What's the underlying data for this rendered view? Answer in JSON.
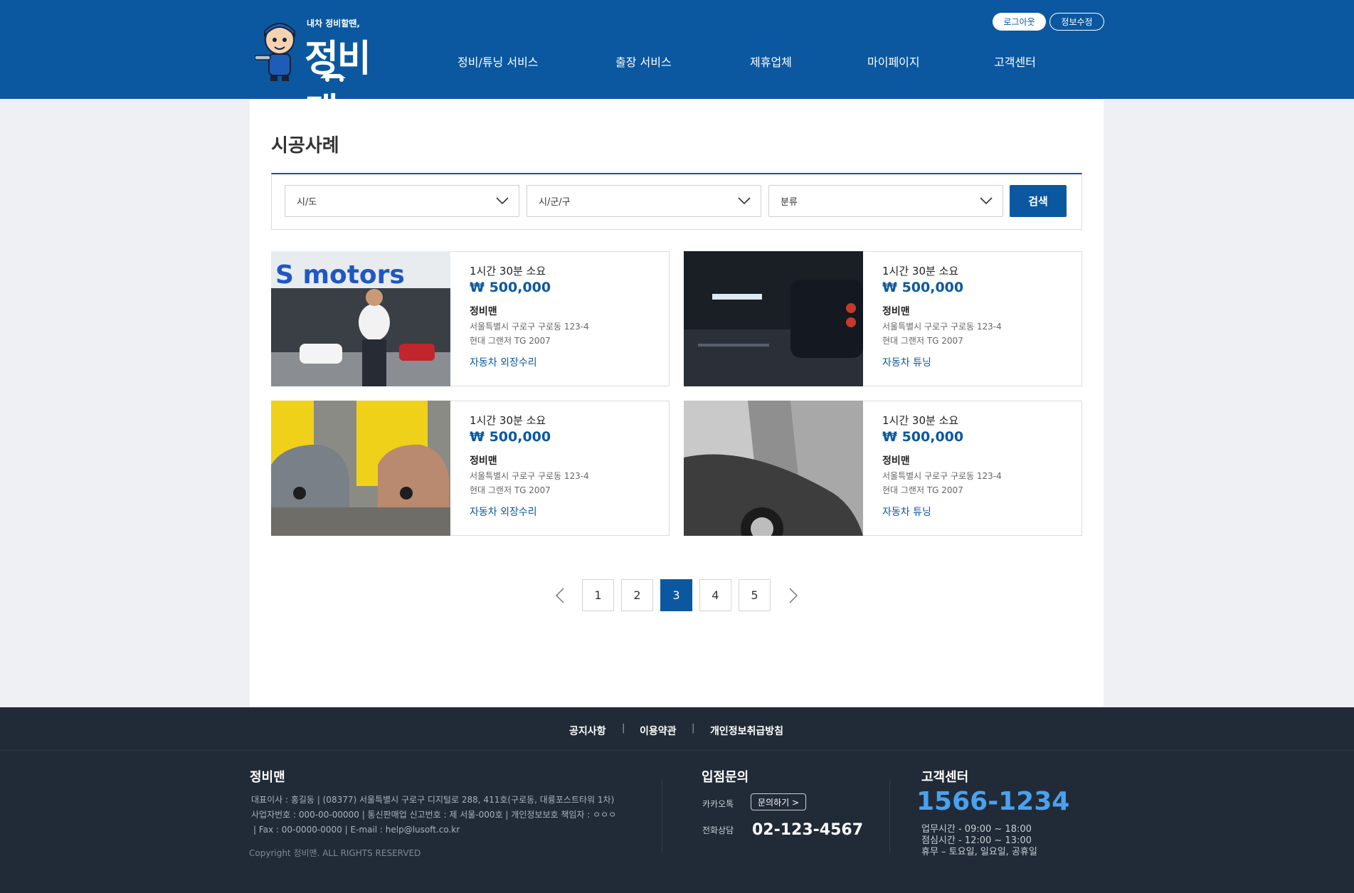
{
  "header": {
    "logo_tagline": "내차 정비할땐,",
    "logo_name": "정비맨",
    "logout": "로그아웃",
    "edit_info": "정보수정",
    "nav": [
      "정비/튜닝 서비스",
      "출장 서비스",
      "제휴업체",
      "마이페이지",
      "고객센터"
    ]
  },
  "main": {
    "title": "시공사례",
    "filters": {
      "sido": "시/도",
      "sigungu": "시/군/구",
      "category": "분류",
      "search": "검색"
    },
    "cards": [
      {
        "time": "1시간 30분 소요",
        "price": "₩ 500,000",
        "shop": "정비맨",
        "address": "서울특별시 구로구 구로동 123-4",
        "car": "현대 그랜저 TG 2007",
        "category": "자동차 외장수리",
        "image_text": "S motors"
      },
      {
        "time": "1시간 30분 소요",
        "price": "₩ 500,000",
        "shop": "정비맨",
        "address": "서울특별시 구로구 구로동 123-4",
        "car": "현대 그랜저 TG 2007",
        "category": "자동차 튜닝"
      },
      {
        "time": "1시간 30분 소요",
        "price": "₩ 500,000",
        "shop": "정비맨",
        "address": "서울특별시 구로구 구로동 123-4",
        "car": "현대 그랜저 TG 2007",
        "category": "자동차 외장수리"
      },
      {
        "time": "1시간 30분 소요",
        "price": "₩ 500,000",
        "shop": "정비맨",
        "address": "서울특별시 구로구 구로동 123-4",
        "car": "현대 그랜저 TG 2007",
        "category": "자동차 튜닝"
      }
    ],
    "pagination": {
      "pages": [
        "1",
        "2",
        "3",
        "4",
        "5"
      ],
      "current": "3"
    }
  },
  "footer": {
    "links": [
      "공지사항",
      "이용약관",
      "개인정보취급방침"
    ],
    "separator": "|",
    "company": {
      "name": "정비맨",
      "line1": "대표이사 : 홍길동 | (08377) 서울특별시 구로구 디지털로 288, 411호(구로동, 대륭포스트타워 1차)",
      "line2": "사업자번호 : 000-00-00000 | 통신판매업 신고번호 : 제 서울-000호 | 개인정보보호 책임자 : ㅇㅇㅇ",
      "line3": "| Fax : 00-0000-0000 | E-mail : help@lusoft.co.kr",
      "copyright": "Copyright 정비맨. ALL RIGHTS RESERVED"
    },
    "store": {
      "title": "입점문의",
      "kakao_label": "카카오톡",
      "inquiry_button": "문의하기 >",
      "phone_label": "전화상담",
      "phone": "02-123-4567"
    },
    "support": {
      "title": "고객센터",
      "number": "1566-1234",
      "hours": "업무시간 - 09:00 ~ 18:00",
      "lunch": "점심시간 - 12:00 ~ 13:00",
      "holiday": "휴무 – 토요일, 일요일, 공휴일"
    }
  },
  "colors": {
    "brand": "#0b58a0",
    "footer": "#212b37",
    "accent": "#4aa1ef"
  }
}
